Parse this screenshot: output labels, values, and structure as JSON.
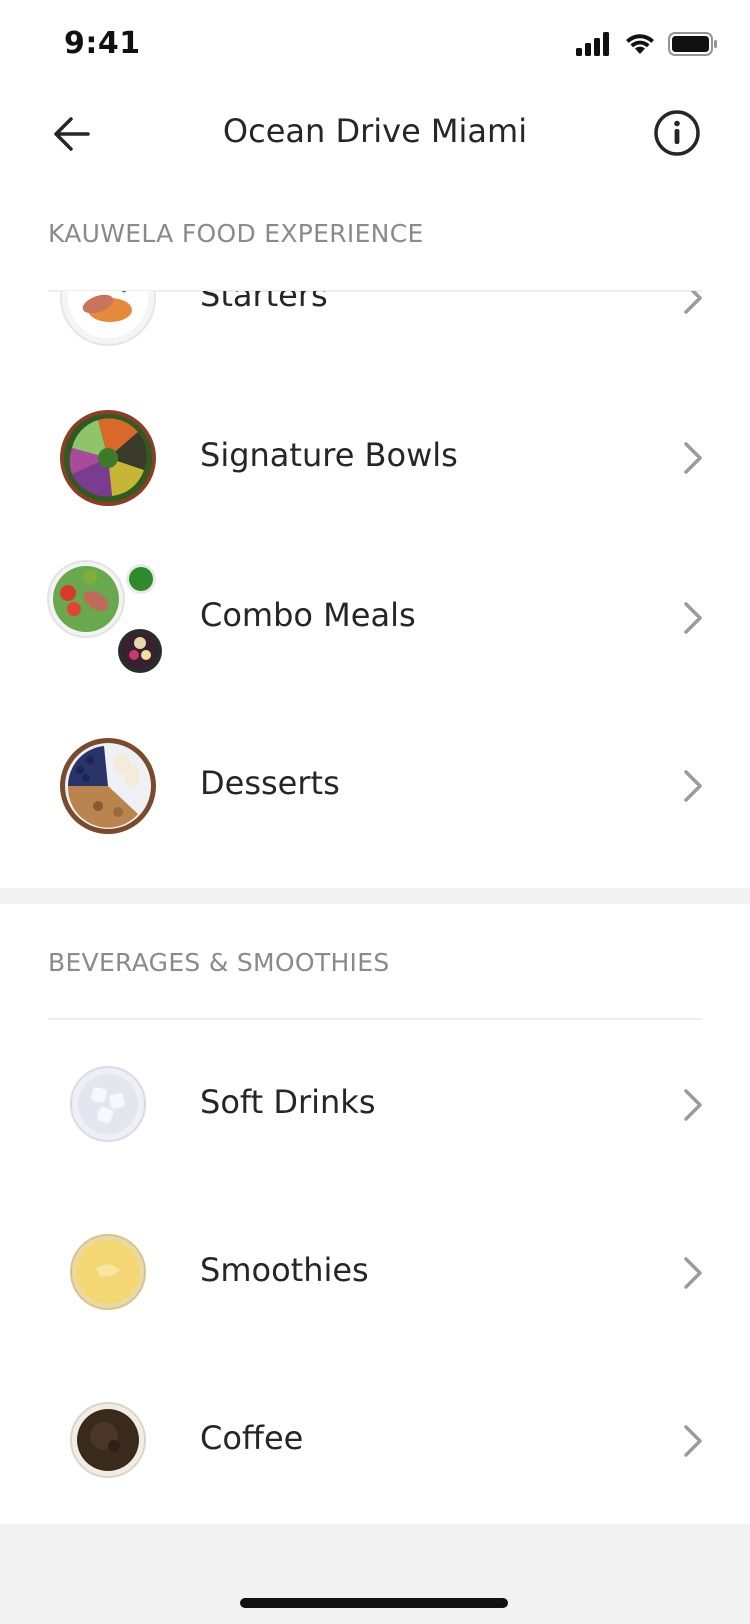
{
  "status_bar": {
    "time": "9:41"
  },
  "nav": {
    "title": "Ocean Drive Miami",
    "back_icon": "back-arrow-icon",
    "info_icon": "info-icon"
  },
  "sections": [
    {
      "header": "KAUWELA FOOD EXPERIENCE",
      "items": [
        {
          "label": "Starters",
          "thumb": "starters-dish"
        },
        {
          "label": "Signature Bowls",
          "thumb": "poke-bowl"
        },
        {
          "label": "Combo Meals",
          "thumb": "combo-plate"
        },
        {
          "label": "Desserts",
          "thumb": "acai-bowl"
        }
      ]
    },
    {
      "header": "BEVERAGES & SMOOTHIES",
      "items": [
        {
          "label": "Soft Drinks",
          "thumb": "ice-glass"
        },
        {
          "label": "Smoothies",
          "thumb": "mango-smoothie"
        },
        {
          "label": "Coffee",
          "thumb": "coffee-cup"
        }
      ]
    }
  ],
  "colors": {
    "text": "#262626",
    "section_header": "#8a8a8a",
    "chevron": "#9b9b9b",
    "divider": "#eeeeee",
    "background_gap": "#f2f2f2"
  }
}
